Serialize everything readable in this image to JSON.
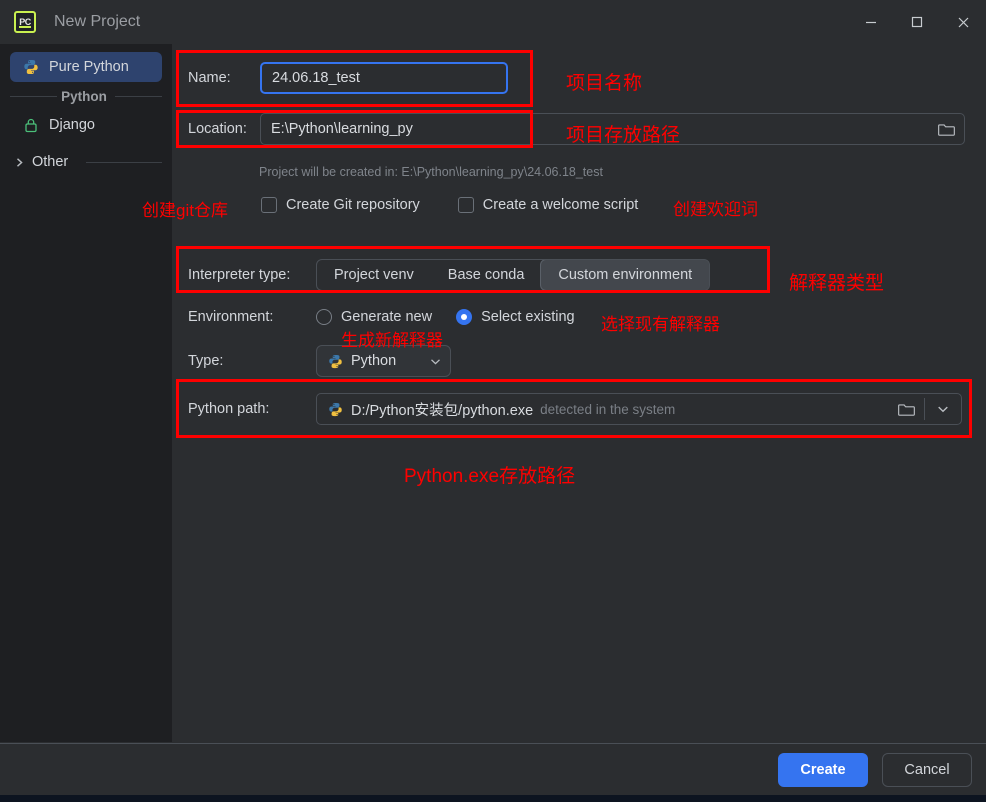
{
  "window": {
    "title": "New Project",
    "app_icon": "pycharm-icon",
    "minimize_label": "Minimize",
    "maximize_label": "Maximize",
    "close_label": "Close"
  },
  "sidebar": {
    "items": [
      {
        "label": "Pure Python",
        "icon": "python-icon",
        "selected": true
      },
      {
        "label": "Python",
        "type": "section"
      },
      {
        "label": "Django",
        "icon": "lock-icon",
        "selected": false
      },
      {
        "label": "Other",
        "icon": "chevron-right-icon",
        "type": "expander"
      }
    ]
  },
  "form": {
    "name": {
      "label": "Name:",
      "value": "24.06.18_test",
      "placeholder": "Project name"
    },
    "location": {
      "label": "Location:",
      "value": "E:\\Python\\learning_py",
      "placeholder": "Project location",
      "browse_icon": "folder-icon"
    },
    "creation_hint": "Project will be created in: E:\\Python\\learning_py\\24.06.18_test",
    "checkboxes": [
      {
        "label": "Create Git repository",
        "checked": false
      },
      {
        "label": "Create a welcome script",
        "checked": false
      }
    ],
    "interpreter_type": {
      "label": "Interpreter type:",
      "options": [
        "Project venv",
        "Base conda",
        "Custom environment"
      ],
      "selected": "Custom environment"
    },
    "environment": {
      "label": "Environment:",
      "options": [
        "Generate new",
        "Select existing"
      ],
      "selected": "Select existing"
    },
    "type": {
      "label": "Type:",
      "value": "Python",
      "icon": "python-icon",
      "chevron": "chevron-down-icon"
    },
    "python_path": {
      "label": "Python path:",
      "value": "D:/Python安装包/python.exe",
      "suffix": "detected in the system",
      "icon": "python-icon",
      "browse_icon": "folder-icon",
      "dropdown_icon": "chevron-down-icon"
    }
  },
  "annotations": {
    "project_name": "项目名称",
    "project_location": "项目存放路径",
    "create_git": "创建git仓库",
    "create_welcome": "创建欢迎词",
    "interpreter_type": "解释器类型",
    "generate_new": "生成新解释器",
    "select_existing": "选择现有解释器",
    "python_exe_path": "Python.exe存放路径"
  },
  "footer": {
    "create_label": "Create",
    "cancel_label": "Cancel"
  },
  "colors": {
    "accent": "#3574f0",
    "annotation": "#fe0000",
    "sidebar_bg": "#1e1f22",
    "panel_bg": "#2b2d30",
    "selected_item": "#2e436e"
  }
}
